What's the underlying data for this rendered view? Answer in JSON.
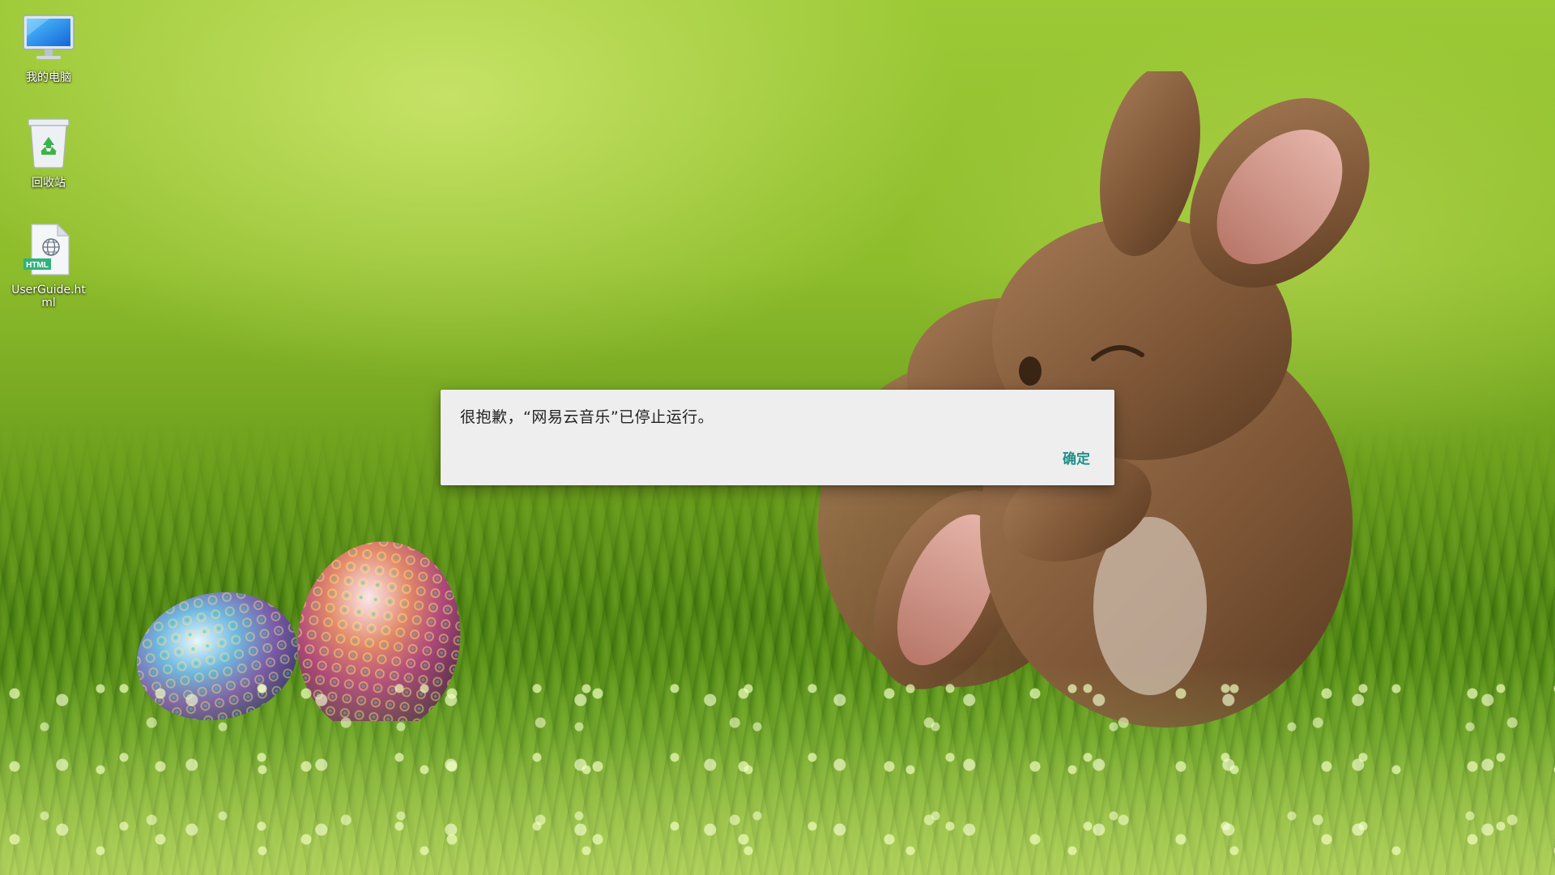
{
  "desktop": {
    "icons": [
      {
        "label": "我的电脑",
        "icon": "computer-monitor-icon"
      },
      {
        "label": "回收站",
        "icon": "recycle-bin-icon"
      },
      {
        "label": "UserGuide.html",
        "icon": "html-file-icon",
        "badge": "HTML"
      }
    ]
  },
  "dialog": {
    "message": "很抱歉，“网易云音乐”已停止运行。",
    "ok_label": "确定"
  },
  "colors": {
    "accent": "#1e8e8a",
    "dialog_bg": "#eeeeee"
  }
}
